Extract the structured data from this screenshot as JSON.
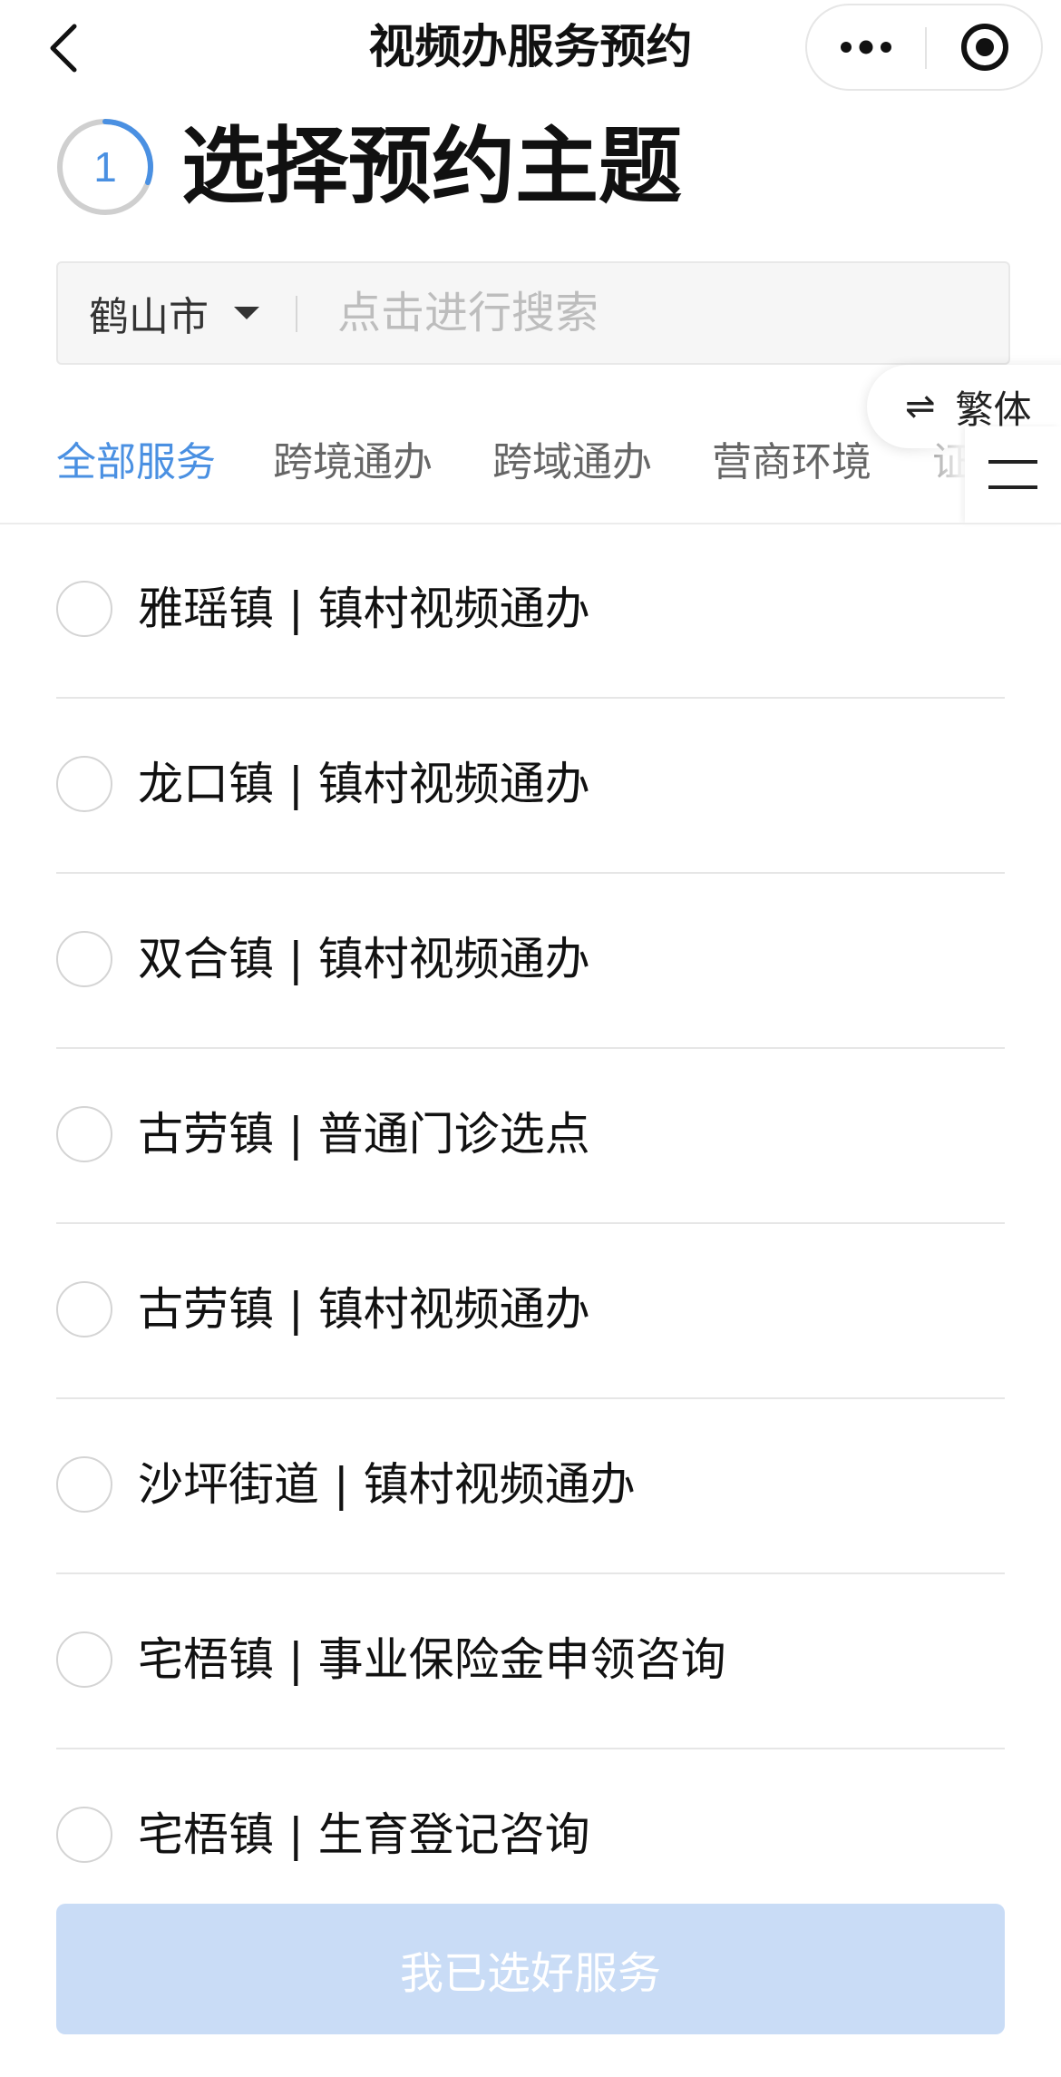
{
  "navbar": {
    "title": "视频办服务预约",
    "back_icon": "chevron-left-icon",
    "more_icon": "more-dots-icon",
    "target_icon": "target-icon"
  },
  "step": {
    "number": "1",
    "title": "选择预约主题",
    "progress_color": "#4a90e2"
  },
  "search": {
    "city": "鹤山市",
    "placeholder": "点击进行搜索"
  },
  "language_toggle": {
    "icon": "swap-arrows-icon",
    "label": "繁体"
  },
  "tabs": [
    {
      "label": "全部服务",
      "active": true
    },
    {
      "label": "跨境通办",
      "active": false
    },
    {
      "label": "跨域通办",
      "active": false
    },
    {
      "label": "营商环境",
      "active": false
    },
    {
      "label": "证",
      "active": false
    }
  ],
  "menu_icon": "hamburger-menu-icon",
  "services": [
    {
      "label": "雅瑶镇 | 镇村视频通办"
    },
    {
      "label": "龙口镇 | 镇村视频通办"
    },
    {
      "label": "双合镇 | 镇村视频通办"
    },
    {
      "label": "古劳镇 | 普通门诊选点"
    },
    {
      "label": "古劳镇 | 镇村视频通办"
    },
    {
      "label": "沙坪街道 | 镇村视频通办"
    },
    {
      "label": "宅梧镇 | 事业保险金申领咨询"
    },
    {
      "label": "宅梧镇 | 生育登记咨询"
    }
  ],
  "confirm_button": {
    "label": "我已选好服务"
  },
  "colors": {
    "accent": "#4a90e2",
    "button_disabled": "#c9dcf6"
  }
}
